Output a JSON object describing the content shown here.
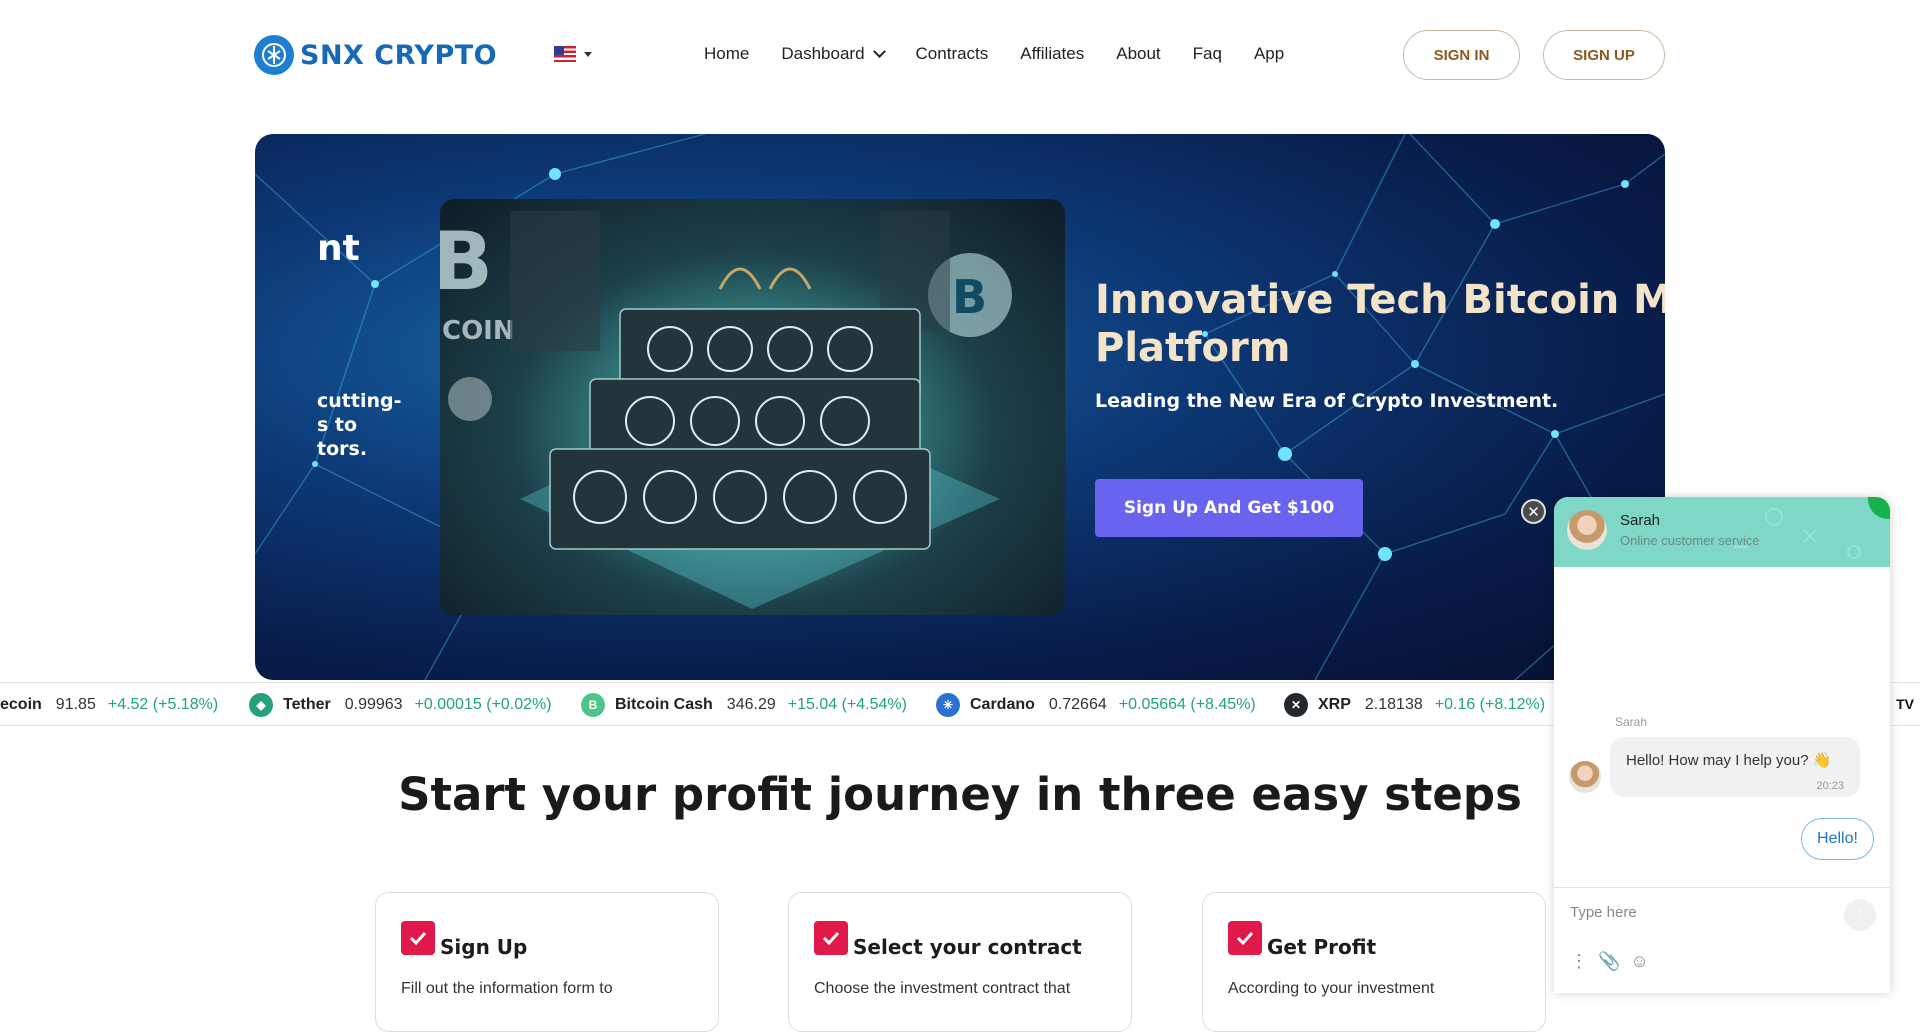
{
  "header": {
    "logo_text": "SNX CRYPTO",
    "language_flag": "us-flag-icon",
    "nav": [
      "Home",
      "Dashboard",
      "Contracts",
      "Affiliates",
      "About",
      "Faq",
      "App"
    ],
    "sign_in": "SIGN IN",
    "sign_up": "SIGN UP"
  },
  "hero": {
    "left_fragments": [
      "nt",
      "cutting-",
      "s to",
      "tors."
    ],
    "title_line1": "Innovative Tech Bitcoin Mi",
    "title_line2": "Platform",
    "subtitle": "Leading the New Era of Crypto Investment.",
    "cta": "Sign Up And Get $100"
  },
  "ticker": [
    {
      "name": "ecoin",
      "price": "91.85",
      "change": "+4.52 (+5.18%)",
      "icon": "",
      "color": ""
    },
    {
      "name": "Tether",
      "price": "0.99963",
      "change": "+0.00015 (+0.02%)",
      "icon": "tether-icon",
      "color": "#26a17b"
    },
    {
      "name": "Bitcoin Cash",
      "price": "346.29",
      "change": "+15.04 (+4.54%)",
      "icon": "bitcoin-cash-icon",
      "color": "#4ec38a"
    },
    {
      "name": "Cardano",
      "price": "0.72664",
      "change": "+0.05664 (+8.45%)",
      "icon": "cardano-icon",
      "color": "#2a71d0"
    },
    {
      "name": "XRP",
      "price": "2.18138",
      "change": "+0.16 (+8.12%)",
      "icon": "xrp-icon",
      "color": "#23292f"
    }
  ],
  "tradingview_badge": "TV",
  "steps": {
    "title": "Start your profit journey in three easy steps",
    "cards": [
      {
        "title": "Sign Up",
        "desc": "Fill out the information form to"
      },
      {
        "title": "Select your contract",
        "desc": "Choose the investment contract that"
      },
      {
        "title": "Get Profit",
        "desc": "According to your investment"
      }
    ]
  },
  "chat": {
    "agent_name": "Sarah",
    "agent_status": "Online customer service",
    "sender_label": "Sarah",
    "message": "Hello! How may I help you? 👋",
    "message_time": "20:23",
    "user_reply": "Hello!",
    "input_placeholder": "Type here"
  },
  "colors": {
    "brand": "#1669b7",
    "cta": "#6a63f0",
    "gain": "#22a37a",
    "check": "#e0194a",
    "chat_header": "#7fd7c6"
  }
}
